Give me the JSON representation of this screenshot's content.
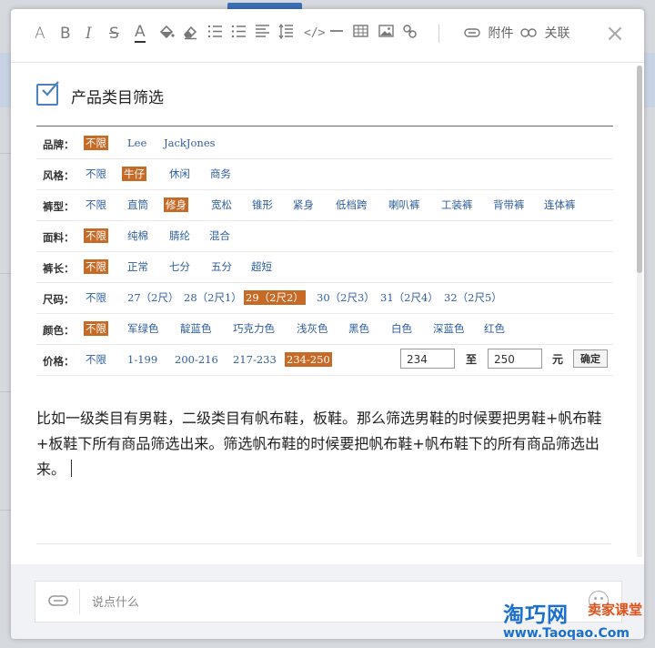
{
  "toolbar": {
    "icons": [
      "text-color-a-icon",
      "bold-icon",
      "italic-icon",
      "strikethrough-icon",
      "underline-icon",
      "fill-bucket-icon",
      "eraser-icon",
      "ordered-list-icon",
      "bullet-list-icon",
      "align-icon",
      "line-spacing-icon",
      "code-icon",
      "horizontal-rule-icon",
      "table-icon",
      "image-icon",
      "link-icon"
    ],
    "glyphs": {
      "a": "A",
      "bold": "B",
      "italic": "I",
      "strike": "S",
      "underline": "A"
    },
    "attachment_label": "附件",
    "relate_label": "关联",
    "close_glyph": "×"
  },
  "task": {
    "title": "产品类目筛选",
    "checked": true
  },
  "filter_screenshot": {
    "rows": [
      {
        "label": "品牌：",
        "options": [
          "不限",
          "Lee",
          "JackJones"
        ],
        "selected": 0
      },
      {
        "label": "风格：",
        "options": [
          "不限",
          "牛仔",
          "休闲",
          "商务"
        ],
        "selected": 1
      },
      {
        "label": "裤型：",
        "options": [
          "不限",
          "直筒",
          "修身",
          "宽松",
          "锥形",
          "紧身",
          "低档跨",
          "喇叭裤",
          "工装裤",
          "背带裤",
          "连体裤"
        ],
        "selected": 2
      },
      {
        "label": "面料：",
        "options": [
          "不限",
          "纯棉",
          "腈纶",
          "混合"
        ],
        "selected": 0
      },
      {
        "label": "裤长：",
        "options": [
          "不限",
          "正常",
          "七分",
          "五分",
          "超短"
        ],
        "selected": 0
      },
      {
        "label": "尺码：",
        "options": [
          "不限",
          "27（2尺）",
          "28（2尺1）",
          "29（2尺2）",
          "30（2尺3）",
          "31（2尺4）",
          "32（2尺5）"
        ],
        "selected": 3
      },
      {
        "label": "颜色：",
        "options": [
          "不限",
          "军绿色",
          "靛蓝色",
          "巧克力色",
          "浅灰色",
          "黑色",
          "白色",
          "深蓝色",
          "红色"
        ],
        "selected": 0
      },
      {
        "label": "价格：",
        "options": [
          "不限",
          "1-199",
          "200-216",
          "217-233",
          "234-250"
        ],
        "selected": 4
      }
    ],
    "price_min": "234",
    "price_to": "至",
    "price_max": "250",
    "price_unit": "元",
    "confirm_label": "确定"
  },
  "body_text": "比如一级类目有男鞋，二级类目有帆布鞋，板鞋。那么筛选男鞋的时候要把男鞋+帆布鞋+板鞋下所有商品筛选出来。筛选帆布鞋的时候要把帆布鞋+帆布鞋下的所有商品筛选出来。",
  "comment": {
    "placeholder": "说点什么",
    "value": ""
  },
  "watermark": {
    "main": "淘巧网",
    "sub": "卖家课堂",
    "url": "www.Taoqao.Com"
  },
  "colors": {
    "accent": "#4b82c4",
    "selected_option": "#c66a26",
    "link_option": "#2e5e9e",
    "watermark_blue": "#1a6fcf",
    "watermark_orange": "#e0501a"
  }
}
